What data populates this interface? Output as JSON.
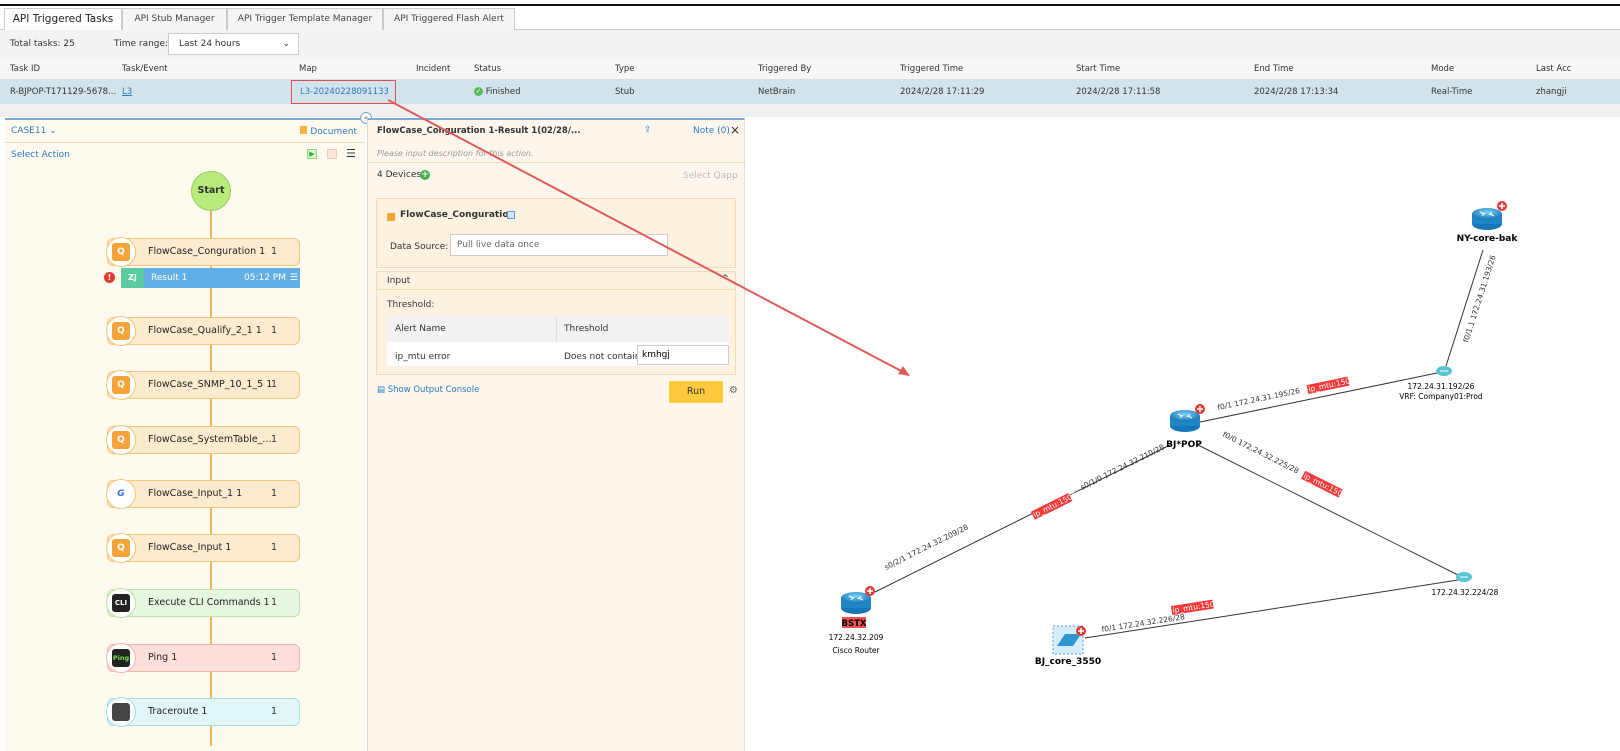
{
  "tabs": [
    "API Triggered Tasks",
    "API Stub Manager",
    "API Trigger Template Manager",
    "API Triggered Flash Alert"
  ],
  "toolbar": {
    "total": "Total tasks: 25",
    "time_label": "Time range:",
    "time_value": "Last 24 hours"
  },
  "table": {
    "headers": [
      "Task ID",
      "Task/Event",
      "Map",
      "Incident",
      "Status",
      "Type",
      "Triggered By",
      "Triggered Time",
      "Start Time",
      "End Time",
      "Mode",
      "Last Acc"
    ],
    "row": [
      "R-BJPOP-T171129-5678...",
      "L3",
      "L3-20240228091133",
      "",
      "Finished",
      "Stub",
      "NetBrain",
      "2024/2/28 17:11:29",
      "2024/2/28 17:11:58",
      "2024/2/28 17:13:34",
      "Real-Time",
      "zhangji"
    ]
  },
  "left": {
    "case": "CASE11",
    "document": "Document",
    "select_action": "Select Action",
    "start": "Start",
    "nodes": [
      {
        "label": "FlowCase_Conguration 1",
        "count": "1",
        "icon": "Q"
      },
      {
        "label": "FlowCase_Qualify_2_1 1",
        "count": "1",
        "icon": "Q"
      },
      {
        "label": "FlowCase_SNMP_10_1_5 1",
        "count": "1",
        "icon": "Q"
      },
      {
        "label": "FlowCase_SystemTable_...",
        "count": "1",
        "icon": "Q"
      },
      {
        "label": "FlowCase_Input_1 1",
        "count": "1",
        "icon": "G"
      },
      {
        "label": "FlowCase_Input 1",
        "count": "1",
        "icon": "Q"
      },
      {
        "label": "Execute CLI Commands 1",
        "count": "1",
        "icon": "CLI"
      },
      {
        "label": "Ping 1",
        "count": "1",
        "icon": "Ping"
      },
      {
        "label": "Traceroute 1",
        "count": "1",
        "icon": "TR"
      }
    ],
    "result": {
      "avatar": "ZJ",
      "label": "Result 1",
      "time": "05:12 PM"
    }
  },
  "mid": {
    "title": "FlowCase_Conguration 1-Result 1(02/28/...",
    "note": "Note (0)",
    "desc_placeholder": "Please input description for this action.",
    "devices": "4 Devices",
    "select_qapp": "Select Qapp",
    "qapp": "FlowCase_Conguration",
    "ds_label": "Data Source:",
    "ds_value": "Pull live data once",
    "input": "Input",
    "threshold": "Threshold:",
    "th_headers": [
      "Alert Name",
      "Threshold"
    ],
    "th_row": [
      "ip_mtu error",
      "Does not contain",
      "kmhgj"
    ],
    "console": "Show Output Console",
    "run": "Run"
  },
  "map": {
    "devices": {
      "ny": "NY-core-bak",
      "bjpop": "BJ*POP",
      "bstx": "BSTX",
      "bstx_ip": "172.24.32.209",
      "bstx_type": "Cisco Router",
      "sw": "BJ_core_3550"
    },
    "clouds": {
      "c1": "172.24.31.192/26",
      "c1_vrf": "VRF: Company01:Prod",
      "c2": "172.24.32.224/28"
    },
    "links": {
      "ny": "f0/1.1 172.24.31.193/26",
      "bj_c1": "f0/1 172.24.31.195/26",
      "bj_bstx": "s0/1/0 172.24.32.210/28",
      "bstx": "s0/2/1 172.24.32.209/28",
      "bj_c2": "f0/0 172.24.32.225/28",
      "sw": "f0/1 172.24.32.226/28",
      "mtu": "ip_mtu:1500"
    }
  },
  "colors": {
    "accent": "#2a7cc0",
    "alert": "#e53935",
    "run": "#ffc940"
  }
}
